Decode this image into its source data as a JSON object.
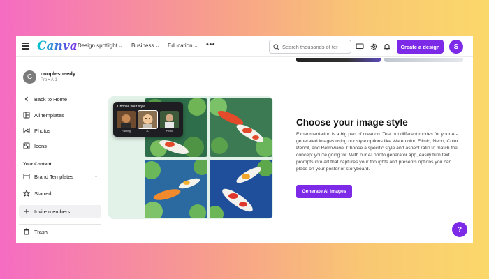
{
  "header": {
    "logo": "Canva",
    "nav": [
      {
        "label": "Design spotlight"
      },
      {
        "label": "Business"
      },
      {
        "label": "Education"
      }
    ],
    "more": "•••",
    "search_placeholder": "Search thousands of ter",
    "create_label": "Create a design",
    "avatar_letter": "S"
  },
  "sidebar": {
    "user": {
      "initial": "C",
      "name": "couplesneedy",
      "plan": "Pro • Å 1"
    },
    "items": [
      {
        "label": "Back to Home"
      },
      {
        "label": "All templates"
      },
      {
        "label": "Photos"
      },
      {
        "label": "Icons"
      }
    ],
    "section_label": "Your Content",
    "content_items": [
      {
        "label": "Brand Templates"
      },
      {
        "label": "Starred"
      },
      {
        "label": "Invite members"
      },
      {
        "label": "Trash"
      }
    ]
  },
  "main": {
    "popup": {
      "title": "Choose your style",
      "styles": [
        {
          "label": "Painting"
        },
        {
          "label": "3D"
        },
        {
          "label": "Photo"
        }
      ]
    },
    "heading": "Choose your image style",
    "body": "Experimentation is a big part of creation. Test out different modes for your AI-generated images using our style options like Watercolor, Filmic, Neon, Color Pencil, and Retrowave. Choose a specific style and aspect ratio to match the concept you're going for. With our AI photo generator app, easily turn text prompts into art that captures your thoughts and presents options you can place on your poster or storyboard.",
    "button_label": "Generate AI Images",
    "help_label": "?"
  },
  "colors": {
    "brand_purple": "#7d2ae8",
    "logo_teal": "#00c4cc"
  }
}
